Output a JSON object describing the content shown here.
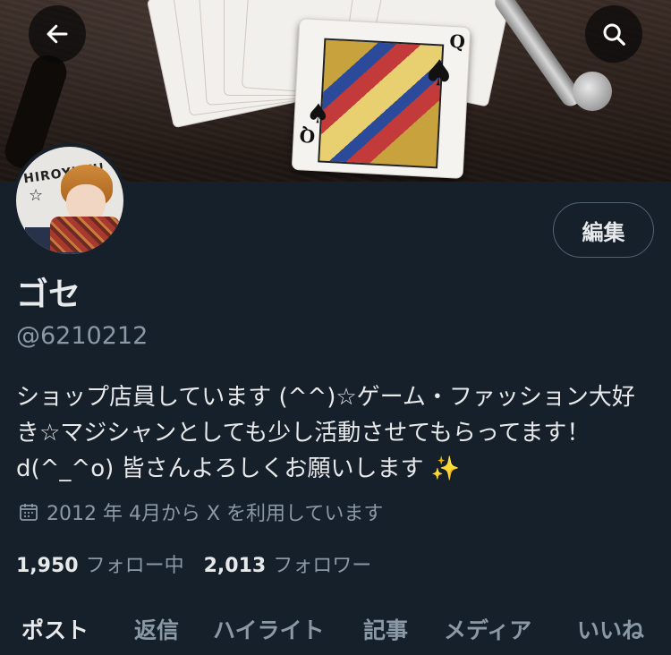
{
  "profile": {
    "display_name": "ゴセ",
    "handle": "@6210212",
    "bio_lines": [
      "ショップ店員しています (^^)☆ゲーム・ファッション大好",
      "き☆マジシャンとしても少し活動させてもらってます！",
      "d(^_^o) 皆さんよろしくお願いします"
    ],
    "bio_emoji": "✨",
    "joined": "2012 年 4月から X を利用しています",
    "avatar_text": "HIROYUKI!",
    "edit_label": "編集"
  },
  "stats": {
    "following_count": "1,950",
    "following_label": "フォロー中",
    "followers_count": "2,013",
    "followers_label": "フォロワー"
  },
  "tabs": [
    {
      "label": "ポスト",
      "active": true
    },
    {
      "label": "返信",
      "active": false
    },
    {
      "label": "ハイライト",
      "active": false
    },
    {
      "label": "記事",
      "active": false
    },
    {
      "label": "メディア",
      "active": false
    },
    {
      "label": "いいね",
      "active": false
    }
  ],
  "icons": {
    "back": "arrow-left-icon",
    "search": "search-icon",
    "calendar": "calendar-icon"
  },
  "colors": {
    "background": "#15202b",
    "text_primary": "#e7e9ea",
    "text_secondary": "#8b98a5",
    "border": "#536471"
  }
}
